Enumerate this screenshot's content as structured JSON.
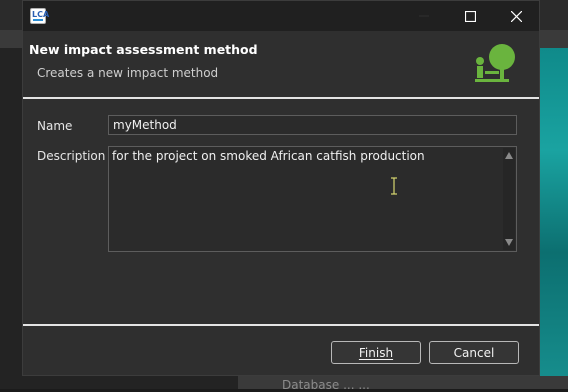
{
  "background": {
    "partial_text": "Database    ...   ..."
  },
  "window": {
    "app_icon_text": "LCA",
    "controls": [
      "minimize-icon",
      "maximize-icon",
      "close-icon"
    ]
  },
  "wizard": {
    "title": "New impact assessment method",
    "subtitle": "Creates a new impact method",
    "icon": "impact-method-icon",
    "accent_color": "#6ab43e"
  },
  "form": {
    "name_label": "Name",
    "name_value": "myMethod",
    "description_label": "Description",
    "description_value": "for the project on smoked African catfish production"
  },
  "buttons": {
    "finish_label": "Finish",
    "cancel_label": "Cancel"
  }
}
